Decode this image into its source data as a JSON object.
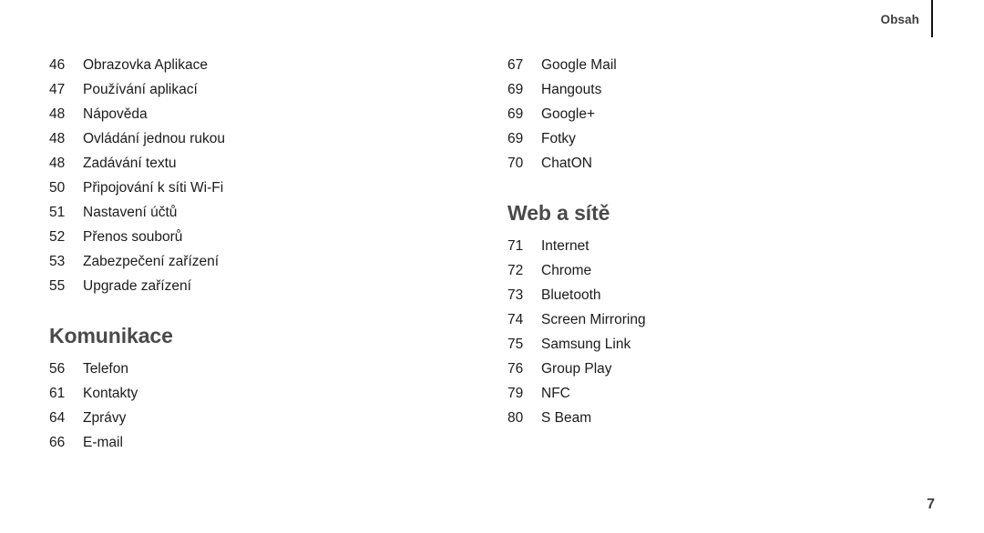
{
  "page": {
    "running_head": "Obsah",
    "folio": "7",
    "text_color": "#1b1b1b",
    "heading_color": "#4a4a4a",
    "background": "#ffffff"
  },
  "columns": [
    {
      "name": "left",
      "groups": [
        {
          "heading": null,
          "entries": [
            {
              "page": "46",
              "title": "Obrazovka Aplikace"
            },
            {
              "page": "47",
              "title": "Používání aplikací"
            },
            {
              "page": "48",
              "title": "Nápověda"
            },
            {
              "page": "48",
              "title": "Ovládání jednou rukou"
            },
            {
              "page": "48",
              "title": "Zadávání textu"
            },
            {
              "page": "50",
              "title": "Připojování k síti Wi-Fi"
            },
            {
              "page": "51",
              "title": "Nastavení účtů"
            },
            {
              "page": "52",
              "title": "Přenos souborů"
            },
            {
              "page": "53",
              "title": "Zabezpečení zařízení"
            },
            {
              "page": "55",
              "title": "Upgrade zařízení"
            }
          ]
        },
        {
          "heading": "Komunikace",
          "entries": [
            {
              "page": "56",
              "title": "Telefon"
            },
            {
              "page": "61",
              "title": "Kontakty"
            },
            {
              "page": "64",
              "title": "Zprávy"
            },
            {
              "page": "66",
              "title": "E-mail"
            }
          ]
        }
      ]
    },
    {
      "name": "right",
      "groups": [
        {
          "heading": null,
          "entries": [
            {
              "page": "67",
              "title": "Google Mail"
            },
            {
              "page": "69",
              "title": "Hangouts"
            },
            {
              "page": "69",
              "title": "Google+"
            },
            {
              "page": "69",
              "title": "Fotky"
            },
            {
              "page": "70",
              "title": "ChatON"
            }
          ]
        },
        {
          "heading": "Web a sítě",
          "entries": [
            {
              "page": "71",
              "title": "Internet"
            },
            {
              "page": "72",
              "title": "Chrome"
            },
            {
              "page": "73",
              "title": "Bluetooth"
            },
            {
              "page": "74",
              "title": "Screen Mirroring"
            },
            {
              "page": "75",
              "title": "Samsung Link"
            },
            {
              "page": "76",
              "title": "Group Play"
            },
            {
              "page": "79",
              "title": "NFC"
            },
            {
              "page": "80",
              "title": "S Beam"
            }
          ]
        }
      ]
    }
  ]
}
